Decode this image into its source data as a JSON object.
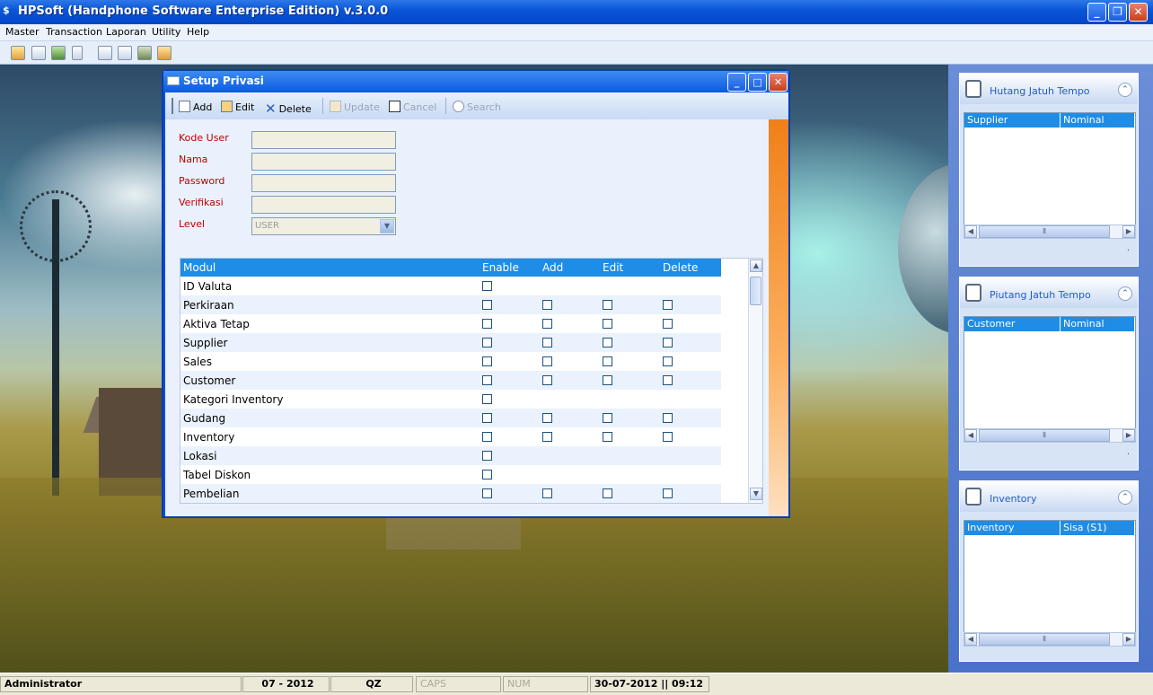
{
  "app": {
    "title": "HPSoft (Handphone Software Enterprise Edition) v.3.0.0",
    "window_buttons": [
      "_",
      "❐",
      "✕"
    ]
  },
  "menu": [
    "Master",
    "Transaction",
    "Laporan",
    "Utility",
    "Help"
  ],
  "toolbar_icons": [
    "open-icon",
    "form-icon",
    "image-icon",
    "device-icon",
    "list-icon",
    "book-icon",
    "tool-icon",
    "folder-icon"
  ],
  "dialog": {
    "title": "Setup Privasi",
    "toolbar": {
      "add": "Add",
      "edit": "Edit",
      "delete": "Delete",
      "update": "Update",
      "cancel": "Cancel",
      "search": "Search"
    },
    "form": {
      "kode_user_label": "Kode User",
      "nama_label": "Nama",
      "password_label": "Password",
      "verifikasi_label": "Verifikasi",
      "level_label": "Level",
      "level_value": "USER"
    },
    "grid": {
      "columns": [
        "Modul",
        "Enable",
        "Add",
        "Edit",
        "Delete"
      ],
      "rows": [
        {
          "modul": "ID Valuta",
          "crud": false
        },
        {
          "modul": "Perkiraan",
          "crud": true
        },
        {
          "modul": "Aktiva Tetap",
          "crud": true
        },
        {
          "modul": "Supplier",
          "crud": true
        },
        {
          "modul": "Sales",
          "crud": true
        },
        {
          "modul": "Customer",
          "crud": true
        },
        {
          "modul": "Kategori Inventory",
          "crud": false
        },
        {
          "modul": "Gudang",
          "crud": true
        },
        {
          "modul": "Inventory",
          "crud": true
        },
        {
          "modul": "Lokasi",
          "crud": false
        },
        {
          "modul": "Tabel Diskon",
          "crud": false
        },
        {
          "modul": "Pembelian",
          "crud": true
        }
      ]
    }
  },
  "panels": [
    {
      "title": "Hutang Jatuh Tempo",
      "col1": "Supplier",
      "col2": "Nominal"
    },
    {
      "title": "Piutang Jatuh Tempo",
      "col1": "Customer",
      "col2": "Nominal"
    },
    {
      "title": "Inventory",
      "col1": "Inventory",
      "col2": "Sisa (S1)"
    }
  ],
  "status": {
    "user": "Administrator",
    "period": "07 - 2012",
    "code": "QZ",
    "caps": "CAPS",
    "num": "NUM",
    "datetime": "30-07-2012 || 09:12"
  }
}
